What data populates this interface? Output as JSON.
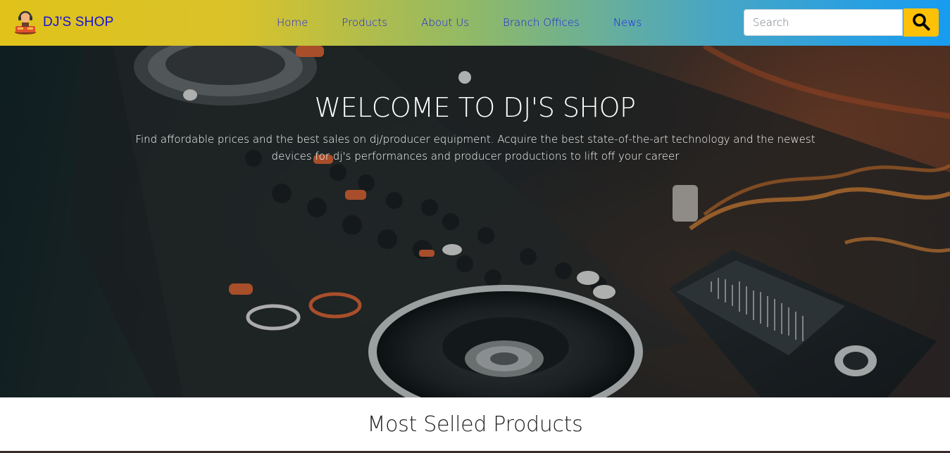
{
  "navbar": {
    "brand": "DJ'S SHOP",
    "links": [
      {
        "label": "Home"
      },
      {
        "label": "Products"
      },
      {
        "label": "About Us"
      },
      {
        "label": "Branch Offices"
      },
      {
        "label": "News"
      }
    ],
    "search": {
      "placeholder": "Search",
      "button_icon": "search-icon"
    },
    "colors": {
      "gradient_start": "#e0c21a",
      "gradient_end": "#179cf2",
      "link": "#1b1fe6",
      "search_button": "#ffc107"
    }
  },
  "hero": {
    "title": "WELCOME TO DJ'S SHOP",
    "description": "Find affordable prices and the best sales on dj/producer equipment. Acquire the best state-of-the-art technology and the newest devices for dj's performances and producer productions to lift off your career",
    "background": "dj-controller-photo"
  },
  "section": {
    "title": "Most Selled Products"
  }
}
